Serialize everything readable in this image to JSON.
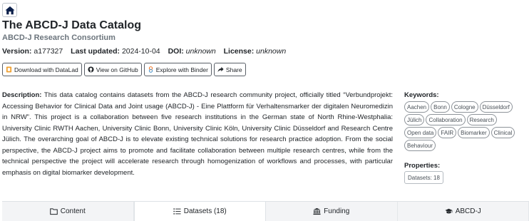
{
  "header": {
    "home_icon": "home-icon",
    "title": "The ABCD-J Data Catalog",
    "subtitle": "ABCD-J Research Consortium"
  },
  "meta": {
    "version_label": "Version:",
    "version_value": "a177327",
    "updated_label": "Last updated:",
    "updated_value": "2024-10-04",
    "doi_label": "DOI:",
    "doi_value": "unknown",
    "license_label": "License:",
    "license_value": "unknown"
  },
  "actions": [
    {
      "label": "Download with DataLad",
      "icon": "datalad-icon"
    },
    {
      "label": "View on GitHub",
      "icon": "github-icon"
    },
    {
      "label": "Explore with Binder",
      "icon": "binder-icon"
    },
    {
      "label": "Share",
      "icon": "share-icon"
    }
  ],
  "description": {
    "label": "Description:",
    "text": "This data catalog contains datasets from the ABCD-J research community project, officially titled “Verbundprojekt: Accessing Behavior for Clinical Data and Joint usage (ABCD-J) - Eine Plattform für Verhaltensmarker der digitalen Neuromedizin in NRW”. This project is a collaboration between five research institutions in the German state of North Rhine-Westphalia: University Clinic RWTH Aachen, University Clinic Bonn, University Clinic Köln, University Clinic Düsseldorf and Research Centre Jülich. The overarching goal of ABCD-J is to elevate existing technical solutions for research practice adoption. From the social perspective, the ABCD-J project aims to promote and facilitate collaboration between multiple research centres, while from the technical perspective the project will accelerate research through homogenization of workflows and processes, with particular emphasis on digital biomarker development."
  },
  "keywords": {
    "label": "Keywords:",
    "items": [
      "Aachen",
      "Bonn",
      "Cologne",
      "Düsseldorf",
      "Jülich",
      "Collaboration",
      "Research",
      "Open data",
      "FAIR",
      "Biomarker",
      "Clinical",
      "Behaviour"
    ]
  },
  "properties": {
    "label": "Properties:",
    "datasets": "Datasets: 18"
  },
  "tabs": [
    {
      "label": "Content",
      "icon": "folder-icon",
      "active": false
    },
    {
      "label": "Datasets (18)",
      "icon": "list-icon",
      "active": true
    },
    {
      "label": "Funding",
      "icon": "bank-icon",
      "active": false
    },
    {
      "label": "ABCD-J",
      "icon": "graduation-cap-icon",
      "active": false
    }
  ]
}
